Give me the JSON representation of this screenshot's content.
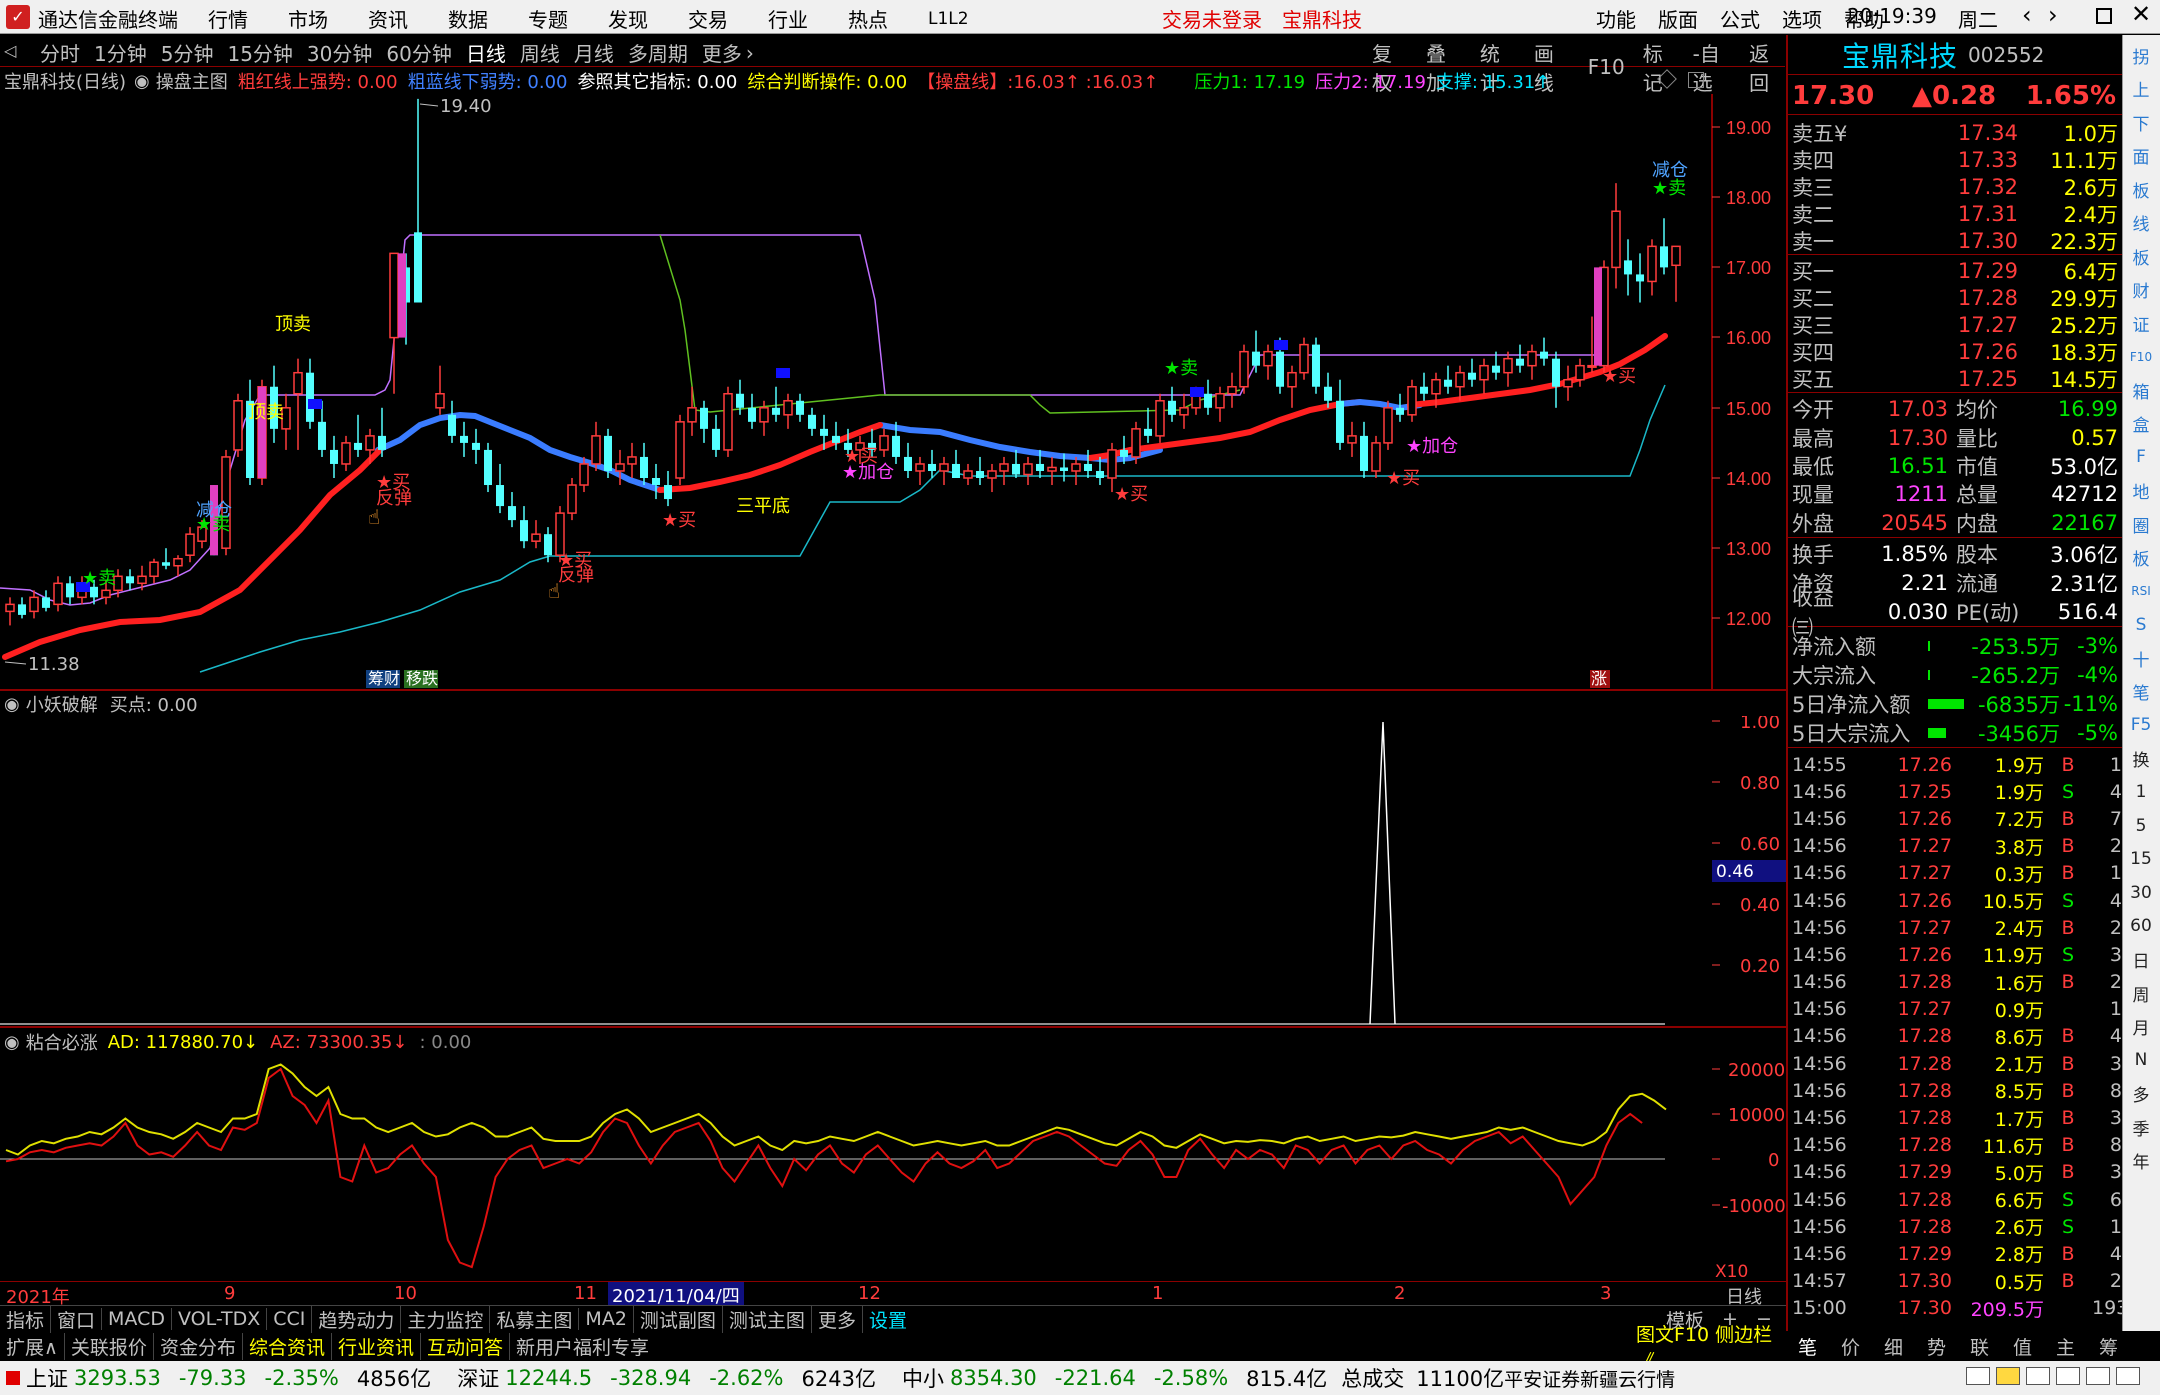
{
  "topbar": {
    "app_title": "通达信金融终端",
    "menus": [
      "行情",
      "市场",
      "资讯",
      "数据",
      "专题",
      "发现",
      "交易",
      "行业",
      "热点",
      "L1L2"
    ],
    "login_status": "交易未登录",
    "stock_name": "宝鼎科技",
    "right_menus": [
      "功能",
      "版面",
      "公式",
      "选项",
      "帮助"
    ],
    "time": "20:19:39",
    "weekday": "周二"
  },
  "period_bar": {
    "periods": [
      "分时",
      "1分钟",
      "5分钟",
      "15分钟",
      "30分钟",
      "60分钟",
      "日线",
      "周线",
      "月线",
      "多周期",
      "更多"
    ],
    "active": "日线",
    "tools": [
      "复权",
      "叠加",
      "统计",
      "画线",
      "F10",
      "标记",
      "-自选",
      "返回"
    ]
  },
  "main_chart": {
    "title": "宝鼎科技(日线)",
    "indicator": "操盘主图",
    "legend": [
      {
        "label": "粗红线上强势: 0.00",
        "color": "#ff3c3c"
      },
      {
        "label": "粗蓝线下弱势: 0.00",
        "color": "#4080ff"
      },
      {
        "label": "参照其它指标: 0.00",
        "color": "#ffffff"
      },
      {
        "label": "综合判断操作: 0.00",
        "color": "#ffff00"
      },
      {
        "label": "【操盘线】:16.03↑ :16.03↑",
        "color": "#ff3c3c"
      },
      {
        "label": "压力1: 17.19",
        "color": "#00e600"
      },
      {
        "label": "压力2: 17.19",
        "color": "#ff44ff"
      },
      {
        "label": "支撑: 15.31↑",
        "color": "#00e5ff"
      }
    ],
    "y_ticks": [
      "19.00",
      "18.00",
      "17.00",
      "16.00",
      "15.00",
      "14.00",
      "13.00",
      "12.00"
    ],
    "high_label": "19.40",
    "low_label": "11.38",
    "annotations": [
      {
        "text": "顶卖",
        "color": "#ffff00"
      },
      {
        "text": "顶卖",
        "color": "#ffff00"
      },
      {
        "text": "减仓",
        "color": "#4fa3ff"
      },
      {
        "text": "★卖",
        "color": "#00e600"
      },
      {
        "text": "★卖",
        "color": "#00e600"
      },
      {
        "text": "★卖",
        "color": "#00e600"
      },
      {
        "text": "★卖",
        "color": "#00e600"
      },
      {
        "text": "减仓",
        "color": "#4fa3ff"
      },
      {
        "text": "★买",
        "color": "#ff3c3c"
      },
      {
        "text": "反弹",
        "color": "#ff3c3c"
      },
      {
        "text": "★买",
        "color": "#ff3c3c"
      },
      {
        "text": "反弹",
        "color": "#ff3c3c"
      },
      {
        "text": "★买",
        "color": "#ff3c3c"
      },
      {
        "text": "三平底",
        "color": "#ffff00"
      },
      {
        "text": "★加仓",
        "color": "#ff44ff"
      },
      {
        "text": "★买",
        "color": "#ff3c3c"
      },
      {
        "text": "★买",
        "color": "#ff3c3c"
      },
      {
        "text": "★加仓",
        "color": "#ff44ff"
      },
      {
        "text": "★买",
        "color": "#ff3c3c"
      }
    ],
    "badges": [
      "筹财",
      "移跌",
      "涨"
    ]
  },
  "sub1": {
    "title": "小妖破解",
    "value": "买点: 0.00",
    "y_ticks": [
      "1.00",
      "0.80",
      "0.60",
      "0.40",
      "0.20"
    ],
    "cursor_value": "0.46"
  },
  "sub2": {
    "title": "粘合必涨",
    "ad": "AD: 117880.70↓",
    "az": "AZ: 73300.35↓",
    "extra": ": 0.00",
    "y_ticks": [
      "20000",
      "10000",
      "0",
      "-10000"
    ],
    "scale": "X10"
  },
  "x_axis": {
    "labels": [
      "2021年",
      "9",
      "10",
      "11",
      "2021/11/04/四",
      "12",
      "1",
      "2",
      "3"
    ],
    "period": "日线"
  },
  "bottom_tabs": {
    "row1": [
      "指标",
      "窗口",
      "MACD",
      "VOL-TDX",
      "CCI",
      "趋势动力",
      "主力监控",
      "私募主图",
      "MA2",
      "测试副图",
      "测试主图",
      "更多",
      "设置"
    ],
    "row1_right": [
      "模板",
      "+",
      "−"
    ],
    "row2": [
      "扩展∧",
      "关联报价",
      "资金分布",
      "综合资讯",
      "行业资讯",
      "互动问答",
      "新用户福利专享"
    ],
    "row2_right": "图文F10 侧边栏《",
    "side_tabs": [
      "笔",
      "价",
      "细",
      "势",
      "联",
      "值",
      "主",
      "筹"
    ]
  },
  "status_bar": {
    "indices": [
      {
        "name": "上证",
        "value": "3293.53",
        "change": "-79.33",
        "pct": "-2.35%",
        "amount": "4856亿"
      },
      {
        "name": "深证",
        "value": "12244.5",
        "change": "-328.94",
        "pct": "-2.62%",
        "amount": "6243亿"
      },
      {
        "name": "中小",
        "value": "8354.30",
        "change": "-221.64",
        "pct": "-2.58%",
        "amount": "815.4亿"
      }
    ],
    "total_label": "总成交",
    "total_value": "11100亿",
    "broker": "平安证券新疆云行情"
  },
  "quote_panel": {
    "name": "宝鼎科技",
    "code": "002552",
    "price": "17.30",
    "change": "▲0.28",
    "pct": "1.65%",
    "asks": [
      {
        "label": "卖五¥",
        "price": "17.34",
        "vol": "1.0万"
      },
      {
        "label": "卖四",
        "price": "17.33",
        "vol": "11.1万"
      },
      {
        "label": "卖三",
        "price": "17.32",
        "vol": "2.6万"
      },
      {
        "label": "卖二",
        "price": "17.31",
        "vol": "2.4万"
      },
      {
        "label": "卖一",
        "price": "17.30",
        "vol": "22.3万"
      }
    ],
    "bids": [
      {
        "label": "买一",
        "price": "17.29",
        "vol": "6.4万"
      },
      {
        "label": "买二",
        "price": "17.28",
        "vol": "29.9万"
      },
      {
        "label": "买三",
        "price": "17.27",
        "vol": "25.2万"
      },
      {
        "label": "买四",
        "price": "17.26",
        "vol": "18.3万"
      },
      {
        "label": "买五",
        "price": "17.25",
        "vol": "14.5万"
      }
    ],
    "stats": [
      {
        "l1": "今开",
        "v1": "17.03",
        "c1": "red",
        "l2": "均价",
        "v2": "16.99",
        "c2": "green"
      },
      {
        "l1": "最高",
        "v1": "17.30",
        "c1": "red",
        "l2": "量比",
        "v2": "0.57",
        "c2": "yellow"
      },
      {
        "l1": "最低",
        "v1": "16.51",
        "c1": "green",
        "l2": "市值",
        "v2": "53.0亿",
        "c2": "white"
      },
      {
        "l1": "现量",
        "v1": "1211",
        "c1": "magenta",
        "l2": "总量",
        "v2": "42712",
        "c2": "white"
      },
      {
        "l1": "外盘",
        "v1": "20545",
        "c1": "red",
        "l2": "内盘",
        "v2": "22167",
        "c2": "green"
      }
    ],
    "stats2": [
      {
        "l1": "换手",
        "v1": "1.85%",
        "l2": "股本",
        "v2": "3.06亿"
      },
      {
        "l1": "净资",
        "v1": "2.21",
        "l2": "流通",
        "v2": "2.31亿"
      },
      {
        "l1": "收益㈢",
        "v1": "0.030",
        "l2": "PE(动)",
        "v2": "516.4"
      }
    ],
    "flows": [
      {
        "label": "净流入额",
        "value": "-253.5万",
        "pct": "-3%",
        "bar": 2
      },
      {
        "label": "大宗流入",
        "value": "-265.2万",
        "pct": "-4%",
        "bar": 2
      },
      {
        "label": "5日净流入额",
        "value": "-6835万",
        "pct": "-11%",
        "bar": 36
      },
      {
        "label": "5日大宗流入",
        "value": "-3456万",
        "pct": "-5%",
        "bar": 18
      }
    ],
    "ticks": [
      {
        "t": "14:55",
        "p": "17.26",
        "v": "1.9万",
        "d": "B",
        "n": "1",
        "pc": "red"
      },
      {
        "t": "14:56",
        "p": "17.25",
        "v": "1.9万",
        "d": "S",
        "n": "4",
        "pc": "red"
      },
      {
        "t": "14:56",
        "p": "17.26",
        "v": "7.2万",
        "d": "B",
        "n": "7",
        "pc": "red"
      },
      {
        "t": "14:56",
        "p": "17.27",
        "v": "3.8万",
        "d": "B",
        "n": "2",
        "pc": "red"
      },
      {
        "t": "14:56",
        "p": "17.27",
        "v": "0.3万",
        "d": "B",
        "n": "1",
        "pc": "red"
      },
      {
        "t": "14:56",
        "p": "17.26",
        "v": "10.5万",
        "d": "S",
        "n": "4",
        "pc": "red"
      },
      {
        "t": "14:56",
        "p": "17.27",
        "v": "2.4万",
        "d": "B",
        "n": "2",
        "pc": "red"
      },
      {
        "t": "14:56",
        "p": "17.26",
        "v": "11.9万",
        "d": "S",
        "n": "3",
        "pc": "red"
      },
      {
        "t": "14:56",
        "p": "17.28",
        "v": "1.6万",
        "d": "B",
        "n": "2",
        "pc": "red"
      },
      {
        "t": "14:56",
        "p": "17.27",
        "v": "0.9万",
        "d": "",
        "n": "1",
        "pc": "red"
      },
      {
        "t": "14:56",
        "p": "17.28",
        "v": "8.6万",
        "d": "B",
        "n": "4",
        "pc": "red"
      },
      {
        "t": "14:56",
        "p": "17.28",
        "v": "2.1万",
        "d": "B",
        "n": "3",
        "pc": "red"
      },
      {
        "t": "14:56",
        "p": "17.28",
        "v": "8.5万",
        "d": "B",
        "n": "8",
        "pc": "red"
      },
      {
        "t": "14:56",
        "p": "17.28",
        "v": "1.7万",
        "d": "B",
        "n": "3",
        "pc": "red"
      },
      {
        "t": "14:56",
        "p": "17.28",
        "v": "11.6万",
        "d": "B",
        "n": "8",
        "pc": "red"
      },
      {
        "t": "14:56",
        "p": "17.29",
        "v": "5.0万",
        "d": "B",
        "n": "3",
        "pc": "red"
      },
      {
        "t": "14:56",
        "p": "17.28",
        "v": "6.6万",
        "d": "S",
        "n": "6",
        "pc": "red"
      },
      {
        "t": "14:56",
        "p": "17.28",
        "v": "2.6万",
        "d": "S",
        "n": "1",
        "pc": "red"
      },
      {
        "t": "14:56",
        "p": "17.29",
        "v": "2.8万",
        "d": "B",
        "n": "4",
        "pc": "red"
      },
      {
        "t": "14:57",
        "p": "17.30",
        "v": "0.5万",
        "d": "B",
        "n": "2",
        "pc": "red"
      },
      {
        "t": "15:00",
        "p": "17.30",
        "v": "209.5万",
        "d": "",
        "n": "193",
        "pc": "red"
      }
    ]
  },
  "right_toolbar": {
    "buttons": [
      "拐",
      "上",
      "下",
      "面",
      "板",
      "线",
      "板",
      "财",
      "证",
      "F10",
      "箱",
      "盒",
      "F",
      "地",
      "圈",
      "板",
      "RSI",
      "S",
      "十",
      "笔",
      "F5",
      "换",
      "1",
      "5",
      "15",
      "30",
      "60",
      "日",
      "周",
      "月",
      "N",
      "多",
      "季",
      "年"
    ]
  },
  "colors": {
    "up": "#ff3c3c",
    "down": "#00e600",
    "candle_up": "#ff3c3c",
    "candle_down": "#54ffff",
    "grid_red": "#8b0000"
  }
}
